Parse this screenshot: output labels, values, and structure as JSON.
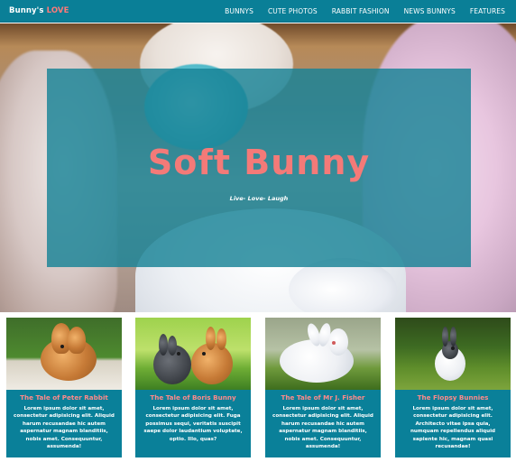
{
  "navbar": {
    "brand_prefix": "Bunny's",
    "brand_accent": "LOVE",
    "links": [
      "BUNNYS",
      "CUTE PHOTOS",
      "RABBIT FASHION",
      "NEWS BUNNYS",
      "FEATURES"
    ]
  },
  "hero": {
    "title": "Soft Bunny",
    "tagline": "Live- Love- Laugh"
  },
  "cards": [
    {
      "title": "The Tale of Peter Rabbit",
      "text": "Lorem ipsum dolor sit amet, consectetur adipisicing elit. Aliquid harum recusandae hic autem aspernatur magnam blanditiis, nobis amet. Consequuntur, assumenda!"
    },
    {
      "title": "The Tale of Boris Bunny",
      "text": "Lorem ipsum dolor sit amet, consectetur adipisicing elit. Fuga possimus sequi, veritatis suscipit saepe dolor laudantium voluptate, optio. Illo, quas?"
    },
    {
      "title": "The Tale of Mr J. Fisher",
      "text": "Lorem ipsum dolor sit amet, consectetur adipisicing elit. Aliquid harum recusandae hic autem aspernatur magnam blanditiis, nobis amet. Consequuntur, assumenda!"
    },
    {
      "title": "The Flopsy Bunnies",
      "text": "Lorem ipsum dolor sit amet, consectetur adipisicing elit. Architecto vitae ipsa quia, numquam repellendus aliquid sapiente hic, magnam quasi recusandae!"
    }
  ],
  "colors": {
    "teal": "#0a7f97",
    "coral": "#f47a78",
    "white": "#ffffff"
  }
}
